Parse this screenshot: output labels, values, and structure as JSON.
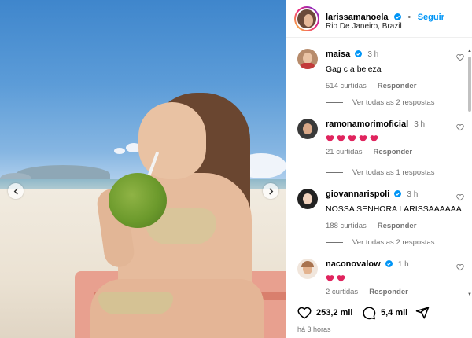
{
  "post": {
    "author": "larissamanoela",
    "location": "Rio De Janeiro, Brazil",
    "follow_label": "Seguir",
    "separator": "•",
    "posted_ago": "há 3 horas"
  },
  "comments": [
    {
      "user": "maisa",
      "time": "3 h",
      "text": "Gag c a beleza",
      "likes": "514 curtidas",
      "reply_label": "Responder",
      "view_replies": "Ver todas as 2 respostas",
      "verified": true
    },
    {
      "user": "ramonamorimoficial",
      "time": "3 h",
      "hearts": 5,
      "likes": "21 curtidas",
      "reply_label": "Responder",
      "view_replies": "Ver todas as 1 respostas",
      "verified": false
    },
    {
      "user": "giovannarispoli",
      "time": "3 h",
      "text": "NOSSA SENHORA LARISSAAAAAA",
      "likes": "188 curtidas",
      "reply_label": "Responder",
      "view_replies": "Ver todas as 2 respostas",
      "verified": true
    },
    {
      "user": "naconovalow",
      "time": "1 h",
      "hearts": 2,
      "likes": "2 curtidas",
      "reply_label": "Responder",
      "verified": true
    }
  ],
  "actions": {
    "likes_count": "253,2 mil",
    "comments_count": "5,4 mil"
  },
  "colors": {
    "accent": "#0095f6",
    "heart": "#e0245e",
    "verified": "#0095f6",
    "muted": "#737373"
  },
  "icons": [
    "chevron-left-icon",
    "chevron-right-icon",
    "verified-icon",
    "heart-outline-icon",
    "comment-icon",
    "share-icon",
    "heart-emoji-icon"
  ]
}
